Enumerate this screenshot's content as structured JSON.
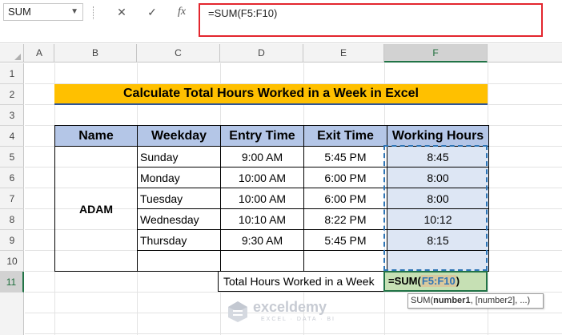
{
  "formula_bar": {
    "name_box": "SUM",
    "cancel_icon": "✕",
    "enter_icon": "✓",
    "fx_label": "fx",
    "formula": "=SUM(F5:F10)"
  },
  "columns": [
    "A",
    "B",
    "C",
    "D",
    "E",
    "F"
  ],
  "active_column": "F",
  "rows": [
    "1",
    "2",
    "3",
    "4",
    "5",
    "6",
    "7",
    "8",
    "9",
    "10",
    "11"
  ],
  "active_row": "11",
  "title": "Calculate Total Hours Worked in a Week in Excel",
  "table": {
    "headers": [
      "Name",
      "Weekday",
      "Entry Time",
      "Exit Time",
      "Working Hours"
    ],
    "name": "ADAM",
    "rows": [
      {
        "weekday": "Sunday",
        "entry": "9:00 AM",
        "exit": "5:45 PM",
        "hours": "8:45"
      },
      {
        "weekday": "Monday",
        "entry": "10:00 AM",
        "exit": "6:00 PM",
        "hours": "8:00"
      },
      {
        "weekday": "Tuesday",
        "entry": "10:00 AM",
        "exit": "6:00 PM",
        "hours": "8:00"
      },
      {
        "weekday": "Wednesday",
        "entry": "10:10 AM",
        "exit": "8:22 PM",
        "hours": "10:12"
      },
      {
        "weekday": "Thursday",
        "entry": "9:30 AM",
        "exit": "5:45 PM",
        "hours": "8:15"
      }
    ]
  },
  "total": {
    "label": "Total Hours Worked in a Week",
    "formula_prefix": "=SUM(",
    "formula_ref": "F5:F10",
    "formula_suffix": ")"
  },
  "tooltip": {
    "fn": "SUM(",
    "arg1": "number1",
    "rest": ", [number2], ...)"
  },
  "watermark": {
    "brand": "exceldemy",
    "tagline": "EXCEL · DATA · BI"
  },
  "colors": {
    "title_bg": "#ffc000",
    "header_bg": "#b4c6e7",
    "selected_range_bg": "#dde6f4",
    "active_cell_bg": "#c6e0b4",
    "formula_highlight_border": "#e3262e"
  }
}
